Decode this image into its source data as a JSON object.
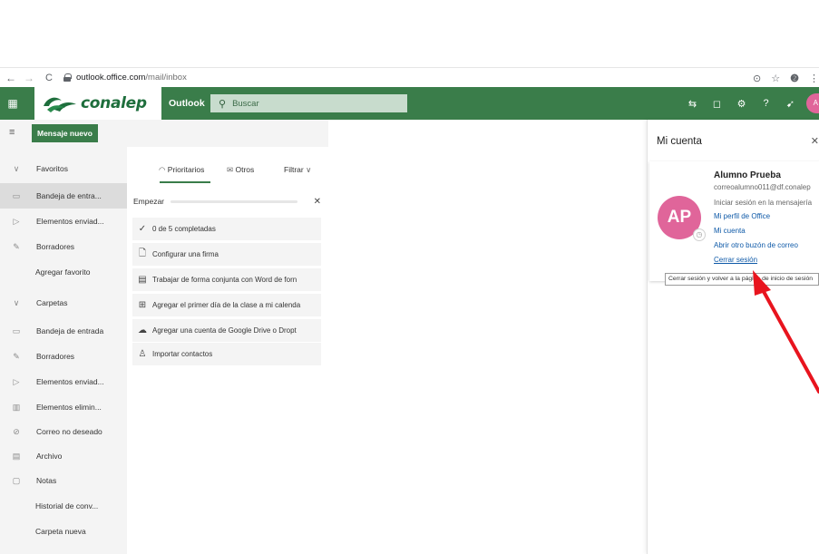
{
  "browser": {
    "url_host": "outlook.office.com",
    "url_path": "/mail/inbox",
    "back_icon": "arrow-left-icon",
    "forward_icon": "arrow-right-icon",
    "reload_icon": "reload-icon"
  },
  "header": {
    "logo_text": "conalep",
    "app_name": "Outlook",
    "search_placeholder": "Buscar",
    "avatar_initials": "A"
  },
  "command_bar": {
    "new_message_label": "Mensaje nuevo"
  },
  "folders": {
    "favorites_label": "Favoritos",
    "favorites": [
      {
        "label": "Bandeja de entra...",
        "icon": "inbox-icon"
      },
      {
        "label": "Elementos enviad...",
        "icon": "send-icon"
      },
      {
        "label": "Borradores",
        "icon": "pencil-icon"
      }
    ],
    "add_favorite_label": "Agregar favorito",
    "folders_label": "Carpetas",
    "folders_list": [
      {
        "label": "Bandeja de entrada",
        "icon": "inbox-icon"
      },
      {
        "label": "Borradores",
        "icon": "pencil-icon"
      },
      {
        "label": "Elementos enviad...",
        "icon": "send-icon"
      },
      {
        "label": "Elementos elimin...",
        "icon": "trash-icon"
      },
      {
        "label": "Correo no deseado",
        "icon": "block-icon"
      },
      {
        "label": "Archivo",
        "icon": "archive-icon"
      },
      {
        "label": "Notas",
        "icon": "note-icon"
      }
    ],
    "history_label": "Historial de conv...",
    "new_folder_label": "Carpeta nueva"
  },
  "message_list": {
    "tab_prioritarios": "Prioritarios",
    "tab_otros": "Otros",
    "filter_label": "Filtrar",
    "empezar_label": "Empezar",
    "tasks": [
      {
        "label": "0 de 5 completadas",
        "icon": "check-icon"
      },
      {
        "label": "Configurar una firma",
        "icon": "signature-icon"
      },
      {
        "label": "Trabajar de forma conjunta con Word de forn",
        "icon": "word-doc-icon"
      },
      {
        "label": "Agregar el primer día de la clase a mi calenda",
        "icon": "calendar-add-icon"
      },
      {
        "label": "Agregar una cuenta de Google Drive o Dropt",
        "icon": "cloud-icon"
      },
      {
        "label": "Importar contactos",
        "icon": "contacts-icon"
      }
    ]
  },
  "account_panel": {
    "title": "Mi cuenta",
    "name": "Alumno Prueba",
    "email": "correoalumno011@df.conalep",
    "im_signin": "Iniciar sesión en la mensajería",
    "avatar_initials": "AP",
    "link_profile": "Mi perfil de Office",
    "link_account": "Mi cuenta",
    "link_other_mailbox": "Abrir otro buzón de correo",
    "link_logout": "Cerrar sesión",
    "tooltip": "Cerrar sesión y volver a la página de inicio de sesión"
  },
  "colors": {
    "brand_green": "#3a7d4a",
    "avatar_pink": "#e0659a",
    "link_blue": "#0f5aa8",
    "annotation_red": "#e8141e"
  }
}
